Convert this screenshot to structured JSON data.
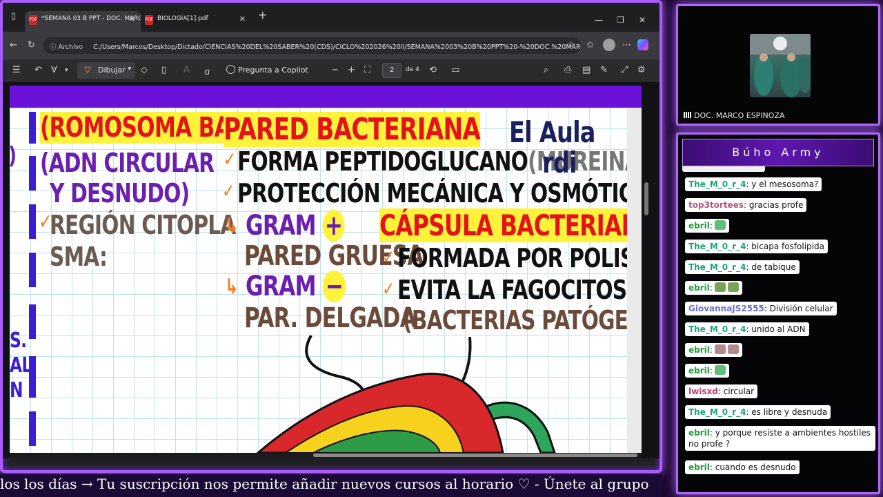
{
  "browser": {
    "tabs": [
      {
        "title": "*SEMANA 03 B PPT - DOC. MARC"
      },
      {
        "title": "BIOLOGÍA[1].pdf"
      }
    ],
    "new_tab": "+",
    "url_scheme_label": "Archivo",
    "url": "C:/Users/Marcos/Desktop/Dictado/CIENCIAS%20DEL%20SABER%20(CDS)/CICLO%202026%20II/SEMANA%2003%20B%20PPT%20-%20DOC.%20MARCO%20..."
  },
  "pdf_toolbar": {
    "draw_label": "Dibujar",
    "copilot_label": "Pregunta a Copilot",
    "page_number": "2",
    "page_total": "de 4"
  },
  "notes": {
    "chromosome_title": "(ROMOSOMA BACT",
    "chromosome_line1": "(ADN CIRCULAR",
    "chromosome_line2": "Y DESNUDO)",
    "chromosome_check": "✓",
    "chromosome_region1": "REGIÓN CITOPLA",
    "chromosome_region2": "SMA:",
    "left_edge_fragment": "S.\nAL\nN",
    "wall_title": "PARED BACTERIANA",
    "wall_item1": "FORMA PEPTIDOGLUCANO",
    "wall_item1_paren": "(MUREINA)",
    "wall_item2": "PROTECCIÓN MECÁNICA Y OSMÓTICA",
    "gram_pos": "GRAM",
    "gram_pos_sign": "+",
    "gram_pos_desc": "PARED GRUESA",
    "gram_neg": "GRAM",
    "gram_neg_sign": "−",
    "gram_neg_desc": "PAR. DELGADA",
    "capsule_title": "CÁPSULA BACTERIANA",
    "capsule_item1": "FORMADA POR POLISACÁR.",
    "capsule_item2": "EVITA LA FAGOCITOSIS",
    "capsule_item3": "(BACTERIAS PATÓGENAS)",
    "logo_line1": "El Aula",
    "logo_line2": "rdi"
  },
  "webcam": {
    "name": "DOC. MARCO ESPINOZA"
  },
  "chat": {
    "title": "Búho Army",
    "messages": [
      {
        "user": "The_M_0_r_4",
        "text": ": y el mesosoma?",
        "user_color": "#1aa37a"
      },
      {
        "user": "top3tortees",
        "text": ": gracias profe",
        "user_color": "#b0577a"
      },
      {
        "user": "ebril",
        "text": ":",
        "user_color": "#1f9d3c",
        "emotes": [
          "#5fbf7a"
        ]
      },
      {
        "user": "The_M_0_r_4",
        "text": ": bicapa fosfolipida",
        "user_color": "#1aa37a"
      },
      {
        "user": "The_M_0_r_4",
        "text": ": de tabique",
        "user_color": "#1aa37a"
      },
      {
        "user": "ebril",
        "text": ":",
        "user_color": "#1f9d3c",
        "emotes": [
          "#7aa35a",
          "#7aa35a"
        ]
      },
      {
        "user": "GiovannaJS2555",
        "text": ": División celular",
        "user_color": "#6a6fd0"
      },
      {
        "user": "The_M_0_r_4",
        "text": ": unido al ADN",
        "user_color": "#1aa37a"
      },
      {
        "user": "ebril",
        "text": ":",
        "user_color": "#1f9d3c",
        "emotes": [
          "#b58a8a",
          "#b58a8a"
        ]
      },
      {
        "user": "ebril",
        "text": ":",
        "user_color": "#1f9d3c",
        "emotes": [
          "#5fbf7a"
        ]
      },
      {
        "user": "lwisxd",
        "text": ": circular",
        "user_color": "#c0406a"
      },
      {
        "user": "The_M_0_r_4",
        "text": ": es libre y desnuda",
        "user_color": "#1aa37a"
      },
      {
        "user": "ebril",
        "text": ": y porque resiste a ambientes hostiles no profe ?",
        "user_color": "#1f9d3c"
      },
      {
        "user": "ebril",
        "text": ": cuando es desnudo",
        "user_color": "#1f9d3c"
      }
    ]
  },
  "ticker": {
    "text": "los los días  →  Tu suscripción nos permite añadir nuevos cursos al horario  ♡  -  Únete al grupo"
  },
  "colors": {
    "frame_glow": "#b266ff",
    "red_ink": "#e3121b",
    "purple_ink": "#6a1fb0",
    "brown_ink": "#6b4a3a",
    "highlight": "#fff23a"
  }
}
